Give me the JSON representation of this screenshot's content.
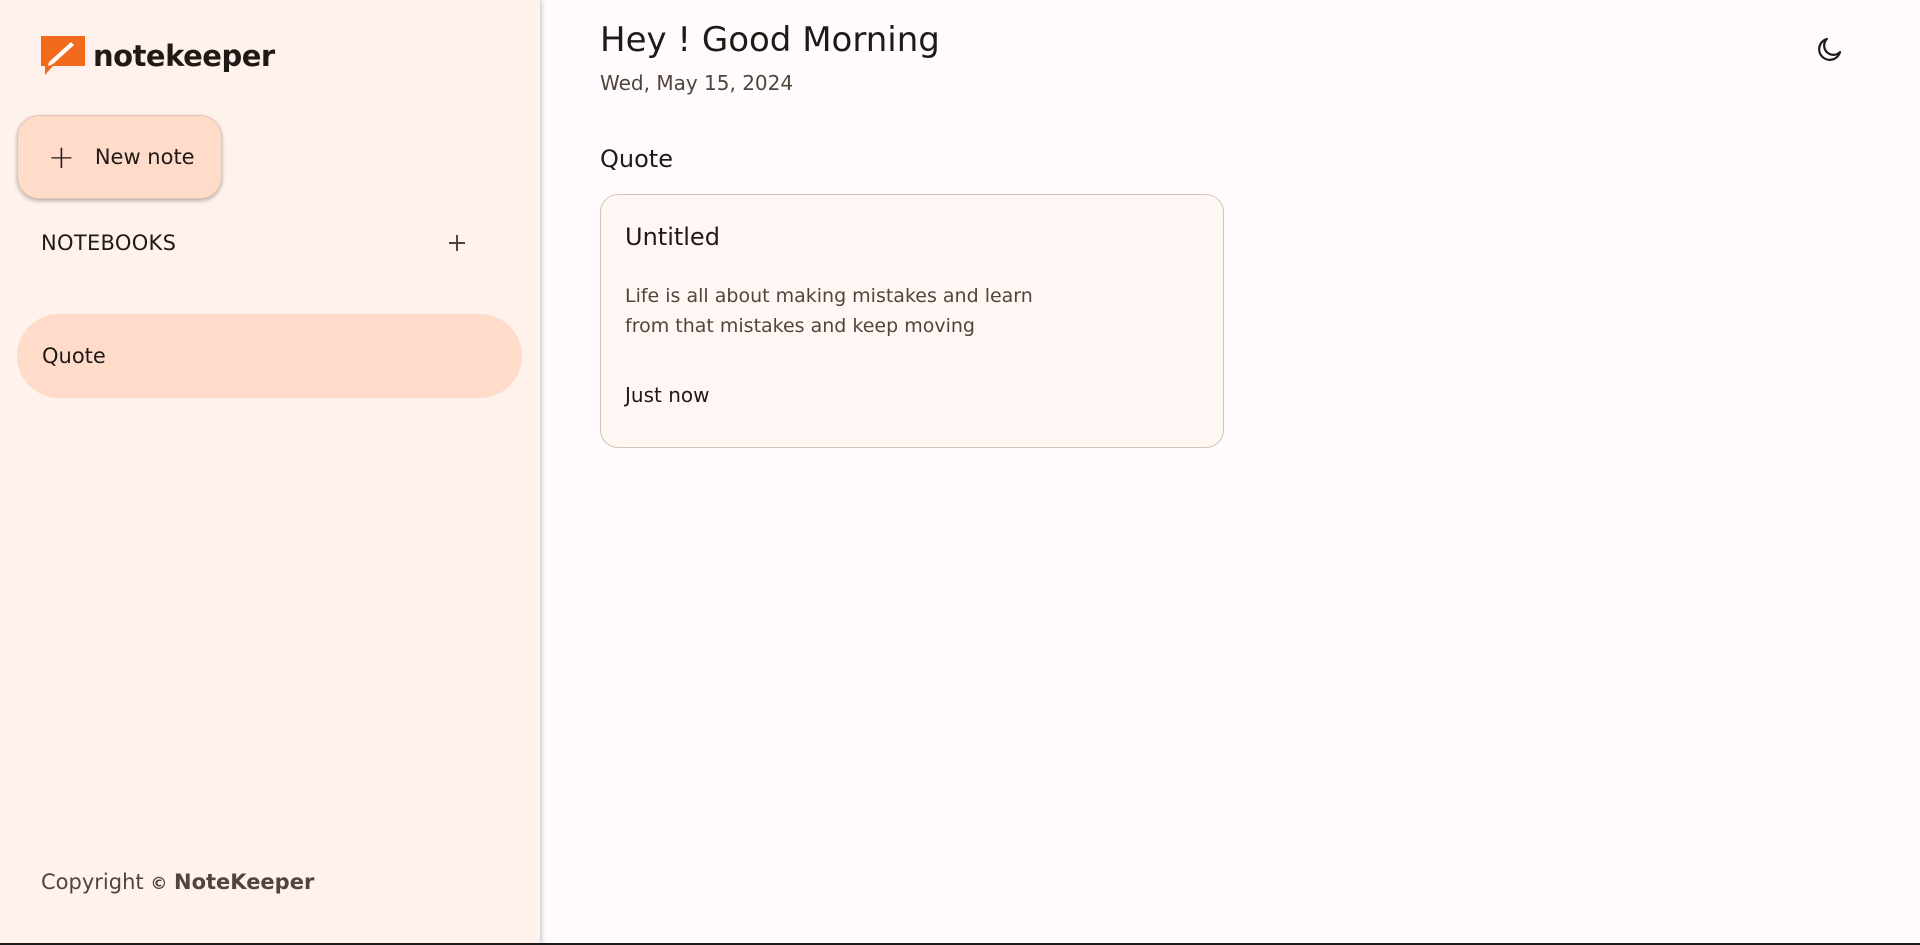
{
  "brand": {
    "name": "notekeeper",
    "logo_icon": "notekeeper-logo-icon",
    "accent": "#f26b1d"
  },
  "sidebar": {
    "new_note_label": "New note",
    "new_note_icon": "plus-icon",
    "notebooks_title": "NOTEBOOKS",
    "add_notebook_icon": "plus-icon",
    "notebooks": [
      {
        "label": "Quote",
        "active": true
      }
    ],
    "copyright": {
      "prefix": "Copyright",
      "symbol": "©",
      "owner": "NoteKeeper"
    }
  },
  "header": {
    "greeting": "Hey ! Good Morning",
    "date": "Wed, May 15, 2024",
    "theme_toggle_icon": "moon-icon"
  },
  "main": {
    "section_title": "Quote",
    "notes": [
      {
        "title": "Untitled",
        "body": "Life is all about making mistakes and learn from that mistakes and keep moving",
        "time": "Just now"
      }
    ]
  },
  "colors": {
    "sidebar_bg": "#fff2ec",
    "active_bg": "#ffdbca",
    "main_bg": "#fffbfd",
    "text": "#201a17"
  }
}
